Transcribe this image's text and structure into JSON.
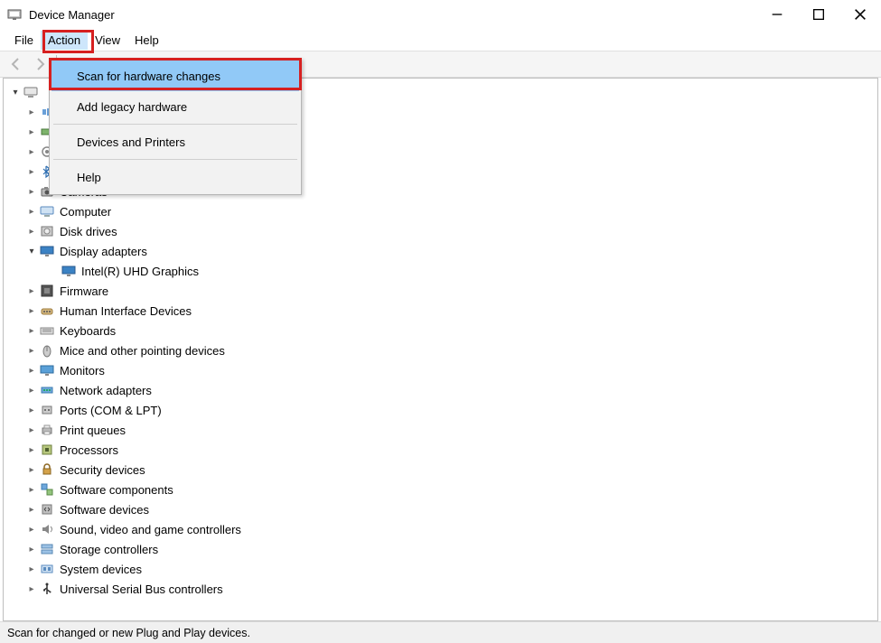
{
  "window": {
    "title": "Device Manager"
  },
  "menu": {
    "file": "File",
    "action": "Action",
    "view": "View",
    "help": "Help"
  },
  "action_menu": {
    "scan": "Scan for hardware changes",
    "add_legacy": "Add legacy hardware",
    "devices_printers": "Devices and Printers",
    "help": "Help"
  },
  "tree": {
    "root_label": "",
    "nodes": [
      {
        "label": "",
        "icon": "audio",
        "depth": 1,
        "chev": "collapsed"
      },
      {
        "label": "",
        "icon": "battery",
        "depth": 1,
        "chev": "collapsed"
      },
      {
        "label": "",
        "icon": "biometric",
        "depth": 1,
        "chev": "collapsed"
      },
      {
        "label": "",
        "icon": "bluetooth",
        "depth": 1,
        "chev": "collapsed"
      },
      {
        "label": "Cameras",
        "icon": "camera",
        "depth": 1,
        "chev": "collapsed"
      },
      {
        "label": "Computer",
        "icon": "computer",
        "depth": 1,
        "chev": "collapsed"
      },
      {
        "label": "Disk drives",
        "icon": "disk",
        "depth": 1,
        "chev": "collapsed"
      },
      {
        "label": "Display adapters",
        "icon": "display",
        "depth": 1,
        "chev": "expanded"
      },
      {
        "label": "Intel(R) UHD Graphics",
        "icon": "display",
        "depth": 2,
        "chev": "none"
      },
      {
        "label": "Firmware",
        "icon": "firmware",
        "depth": 1,
        "chev": "collapsed"
      },
      {
        "label": "Human Interface Devices",
        "icon": "hid",
        "depth": 1,
        "chev": "collapsed"
      },
      {
        "label": "Keyboards",
        "icon": "keyboard",
        "depth": 1,
        "chev": "collapsed"
      },
      {
        "label": "Mice and other pointing devices",
        "icon": "mouse",
        "depth": 1,
        "chev": "collapsed"
      },
      {
        "label": "Monitors",
        "icon": "monitor",
        "depth": 1,
        "chev": "collapsed"
      },
      {
        "label": "Network adapters",
        "icon": "network",
        "depth": 1,
        "chev": "collapsed"
      },
      {
        "label": "Ports (COM & LPT)",
        "icon": "port",
        "depth": 1,
        "chev": "collapsed"
      },
      {
        "label": "Print queues",
        "icon": "print",
        "depth": 1,
        "chev": "collapsed"
      },
      {
        "label": "Processors",
        "icon": "processor",
        "depth": 1,
        "chev": "collapsed"
      },
      {
        "label": "Security devices",
        "icon": "security",
        "depth": 1,
        "chev": "collapsed"
      },
      {
        "label": "Software components",
        "icon": "software-comp",
        "depth": 1,
        "chev": "collapsed"
      },
      {
        "label": "Software devices",
        "icon": "software-dev",
        "depth": 1,
        "chev": "collapsed"
      },
      {
        "label": "Sound, video and game controllers",
        "icon": "sound",
        "depth": 1,
        "chev": "collapsed"
      },
      {
        "label": "Storage controllers",
        "icon": "storage",
        "depth": 1,
        "chev": "collapsed"
      },
      {
        "label": "System devices",
        "icon": "system",
        "depth": 1,
        "chev": "collapsed"
      },
      {
        "label": "Universal Serial Bus controllers",
        "icon": "usb",
        "depth": 1,
        "chev": "collapsed"
      }
    ]
  },
  "status": {
    "text": "Scan for changed or new Plug and Play devices."
  }
}
